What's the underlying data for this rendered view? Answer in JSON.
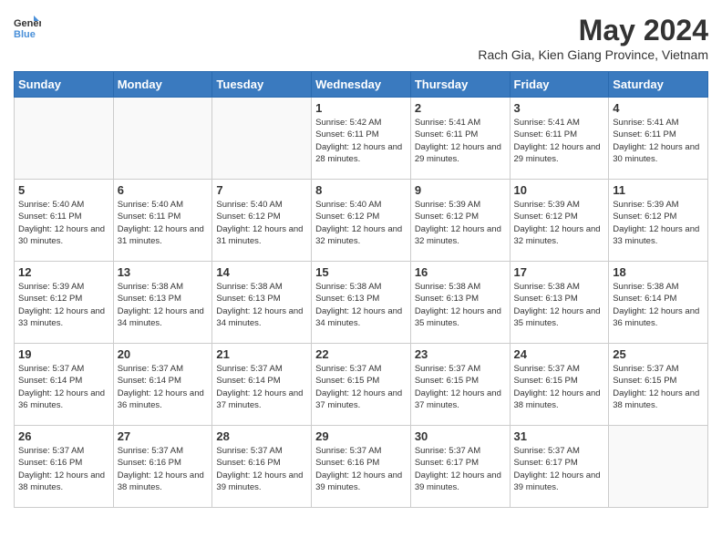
{
  "logo": {
    "text_general": "General",
    "text_blue": "Blue"
  },
  "title": {
    "month_year": "May 2024",
    "location": "Rach Gia, Kien Giang Province, Vietnam"
  },
  "days_of_week": [
    "Sunday",
    "Monday",
    "Tuesday",
    "Wednesday",
    "Thursday",
    "Friday",
    "Saturday"
  ],
  "weeks": [
    {
      "days": [
        {
          "number": "",
          "info": ""
        },
        {
          "number": "",
          "info": ""
        },
        {
          "number": "",
          "info": ""
        },
        {
          "number": "1",
          "info": "Sunrise: 5:42 AM\nSunset: 6:11 PM\nDaylight: 12 hours and 28 minutes."
        },
        {
          "number": "2",
          "info": "Sunrise: 5:41 AM\nSunset: 6:11 PM\nDaylight: 12 hours and 29 minutes."
        },
        {
          "number": "3",
          "info": "Sunrise: 5:41 AM\nSunset: 6:11 PM\nDaylight: 12 hours and 29 minutes."
        },
        {
          "number": "4",
          "info": "Sunrise: 5:41 AM\nSunset: 6:11 PM\nDaylight: 12 hours and 30 minutes."
        }
      ]
    },
    {
      "days": [
        {
          "number": "5",
          "info": "Sunrise: 5:40 AM\nSunset: 6:11 PM\nDaylight: 12 hours and 30 minutes."
        },
        {
          "number": "6",
          "info": "Sunrise: 5:40 AM\nSunset: 6:11 PM\nDaylight: 12 hours and 31 minutes."
        },
        {
          "number": "7",
          "info": "Sunrise: 5:40 AM\nSunset: 6:12 PM\nDaylight: 12 hours and 31 minutes."
        },
        {
          "number": "8",
          "info": "Sunrise: 5:40 AM\nSunset: 6:12 PM\nDaylight: 12 hours and 32 minutes."
        },
        {
          "number": "9",
          "info": "Sunrise: 5:39 AM\nSunset: 6:12 PM\nDaylight: 12 hours and 32 minutes."
        },
        {
          "number": "10",
          "info": "Sunrise: 5:39 AM\nSunset: 6:12 PM\nDaylight: 12 hours and 32 minutes."
        },
        {
          "number": "11",
          "info": "Sunrise: 5:39 AM\nSunset: 6:12 PM\nDaylight: 12 hours and 33 minutes."
        }
      ]
    },
    {
      "days": [
        {
          "number": "12",
          "info": "Sunrise: 5:39 AM\nSunset: 6:12 PM\nDaylight: 12 hours and 33 minutes."
        },
        {
          "number": "13",
          "info": "Sunrise: 5:38 AM\nSunset: 6:13 PM\nDaylight: 12 hours and 34 minutes."
        },
        {
          "number": "14",
          "info": "Sunrise: 5:38 AM\nSunset: 6:13 PM\nDaylight: 12 hours and 34 minutes."
        },
        {
          "number": "15",
          "info": "Sunrise: 5:38 AM\nSunset: 6:13 PM\nDaylight: 12 hours and 34 minutes."
        },
        {
          "number": "16",
          "info": "Sunrise: 5:38 AM\nSunset: 6:13 PM\nDaylight: 12 hours and 35 minutes."
        },
        {
          "number": "17",
          "info": "Sunrise: 5:38 AM\nSunset: 6:13 PM\nDaylight: 12 hours and 35 minutes."
        },
        {
          "number": "18",
          "info": "Sunrise: 5:38 AM\nSunset: 6:14 PM\nDaylight: 12 hours and 36 minutes."
        }
      ]
    },
    {
      "days": [
        {
          "number": "19",
          "info": "Sunrise: 5:37 AM\nSunset: 6:14 PM\nDaylight: 12 hours and 36 minutes."
        },
        {
          "number": "20",
          "info": "Sunrise: 5:37 AM\nSunset: 6:14 PM\nDaylight: 12 hours and 36 minutes."
        },
        {
          "number": "21",
          "info": "Sunrise: 5:37 AM\nSunset: 6:14 PM\nDaylight: 12 hours and 37 minutes."
        },
        {
          "number": "22",
          "info": "Sunrise: 5:37 AM\nSunset: 6:15 PM\nDaylight: 12 hours and 37 minutes."
        },
        {
          "number": "23",
          "info": "Sunrise: 5:37 AM\nSunset: 6:15 PM\nDaylight: 12 hours and 37 minutes."
        },
        {
          "number": "24",
          "info": "Sunrise: 5:37 AM\nSunset: 6:15 PM\nDaylight: 12 hours and 38 minutes."
        },
        {
          "number": "25",
          "info": "Sunrise: 5:37 AM\nSunset: 6:15 PM\nDaylight: 12 hours and 38 minutes."
        }
      ]
    },
    {
      "days": [
        {
          "number": "26",
          "info": "Sunrise: 5:37 AM\nSunset: 6:16 PM\nDaylight: 12 hours and 38 minutes."
        },
        {
          "number": "27",
          "info": "Sunrise: 5:37 AM\nSunset: 6:16 PM\nDaylight: 12 hours and 38 minutes."
        },
        {
          "number": "28",
          "info": "Sunrise: 5:37 AM\nSunset: 6:16 PM\nDaylight: 12 hours and 39 minutes."
        },
        {
          "number": "29",
          "info": "Sunrise: 5:37 AM\nSunset: 6:16 PM\nDaylight: 12 hours and 39 minutes."
        },
        {
          "number": "30",
          "info": "Sunrise: 5:37 AM\nSunset: 6:17 PM\nDaylight: 12 hours and 39 minutes."
        },
        {
          "number": "31",
          "info": "Sunrise: 5:37 AM\nSunset: 6:17 PM\nDaylight: 12 hours and 39 minutes."
        },
        {
          "number": "",
          "info": ""
        }
      ]
    }
  ]
}
